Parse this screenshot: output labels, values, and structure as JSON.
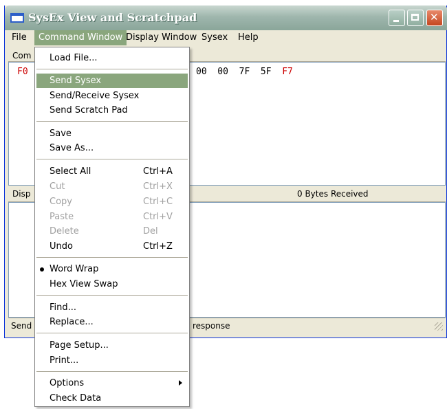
{
  "window": {
    "title": "SysEx View and Scratchpad"
  },
  "menubar": {
    "file": "File",
    "command_window": "Command Window",
    "display_window": "Display Window",
    "sysex": "Sysex",
    "help": "Help"
  },
  "command_pane": {
    "header_visible": "Com",
    "hex_start": "F0",
    "hex_tail": "00  00  7F  5F",
    "hex_end": "F7"
  },
  "display_pane": {
    "header_visible": "Disp",
    "bytes_received": "0  Bytes Received"
  },
  "statusbar": {
    "left_visible": "Send",
    "right": "response"
  },
  "dropdown": {
    "load_file": "Load File...",
    "send_sysex": "Send Sysex",
    "send_receive_sysex": "Send/Receive Sysex",
    "send_scratch_pad": "Send Scratch Pad",
    "save": "Save",
    "save_as": "Save As...",
    "select_all": "Select All",
    "select_all_key": "Ctrl+A",
    "cut": "Cut",
    "cut_key": "Ctrl+X",
    "copy": "Copy",
    "copy_key": "Ctrl+C",
    "paste": "Paste",
    "paste_key": "Ctrl+V",
    "delete": "Delete",
    "delete_key": "Del",
    "undo": "Undo",
    "undo_key": "Ctrl+Z",
    "word_wrap": "Word Wrap",
    "hex_view_swap": "Hex View Swap",
    "find": "Find...",
    "replace": "Replace...",
    "page_setup": "Page Setup...",
    "print": "Print...",
    "options": "Options",
    "check_data": "Check Data"
  }
}
